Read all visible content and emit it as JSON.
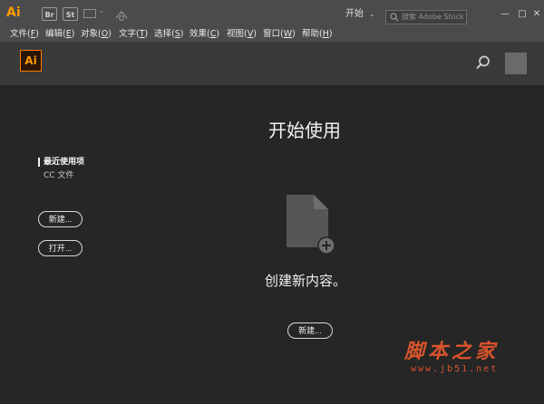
{
  "titlebar": {
    "app_logo": "Ai",
    "bridge_label": "Br",
    "stock_label": "St",
    "workspace_label": "开始",
    "stock_search_placeholder": "搜索 Adobe Stock",
    "minimize": "—",
    "maximize": "□",
    "close": "✕"
  },
  "menu": [
    {
      "label": "文件(",
      "mnemonic": "F",
      "end": ")"
    },
    {
      "label": "编辑(",
      "mnemonic": "E",
      "end": ")"
    },
    {
      "label": "对象(",
      "mnemonic": "O",
      "end": ")"
    },
    {
      "label": "文字(",
      "mnemonic": "T",
      "end": ")"
    },
    {
      "label": "选择(",
      "mnemonic": "S",
      "end": ")"
    },
    {
      "label": "效果(",
      "mnemonic": "C",
      "end": ")"
    },
    {
      "label": "视图(",
      "mnemonic": "V",
      "end": ")"
    },
    {
      "label": "窗口(",
      "mnemonic": "W",
      "end": ")"
    },
    {
      "label": "帮助(",
      "mnemonic": "H",
      "end": ")"
    }
  ],
  "start_header": {
    "logo": "Ai"
  },
  "start": {
    "title": "开始使用",
    "recent": "最近使用项",
    "cc_files": "CC 文件",
    "new_button": "新建...",
    "open_button": "打开...",
    "create_text": "创建新内容。",
    "center_new_button": "新建..."
  },
  "watermark": {
    "title": "脚本之家",
    "url": "www.jb51.net"
  },
  "colors": {
    "accent": "#ff9a00",
    "watermark": "#d8542b"
  }
}
